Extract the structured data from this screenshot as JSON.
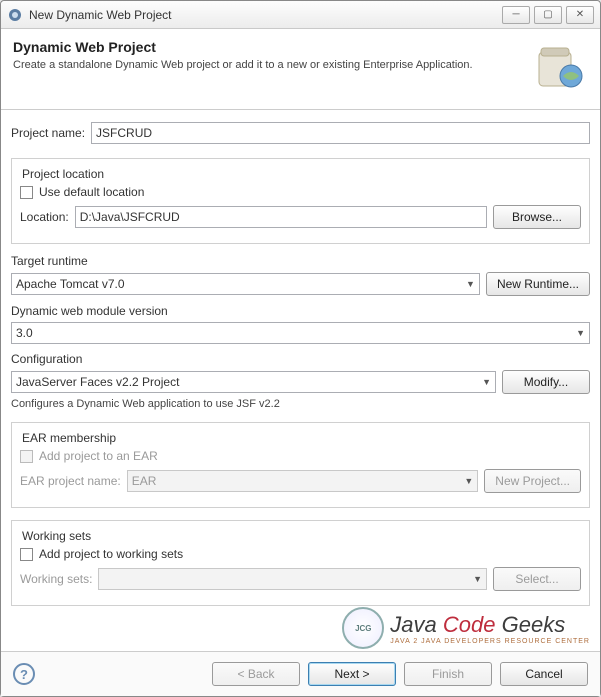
{
  "titlebar": {
    "title": "New Dynamic Web Project"
  },
  "banner": {
    "heading": "Dynamic Web Project",
    "desc": "Create a standalone Dynamic Web project or add it to a new or existing Enterprise Application."
  },
  "project_name": {
    "label": "Project name:",
    "value": "JSFCRUD"
  },
  "project_location": {
    "group": "Project location",
    "use_default_label": "Use default location",
    "use_default_checked": false,
    "location_label": "Location:",
    "location_value": "D:\\Java\\JSFCRUD",
    "browse": "Browse..."
  },
  "target_runtime": {
    "label": "Target runtime",
    "value": "Apache Tomcat v7.0",
    "new_runtime": "New Runtime..."
  },
  "module_version": {
    "label": "Dynamic web module version",
    "value": "3.0"
  },
  "configuration": {
    "label": "Configuration",
    "value": "JavaServer Faces v2.2 Project",
    "modify": "Modify...",
    "hint": "Configures a Dynamic Web application to use JSF v2.2"
  },
  "ear": {
    "group": "EAR membership",
    "add_label": "Add project to an EAR",
    "add_checked": false,
    "project_label": "EAR project name:",
    "project_value": "EAR",
    "new_project": "New Project..."
  },
  "working_sets": {
    "group": "Working sets",
    "add_label": "Add project to working sets",
    "add_checked": false,
    "label": "Working sets:",
    "value": "",
    "select": "Select..."
  },
  "footer": {
    "help": "?",
    "back": "< Back",
    "next": "Next >",
    "finish": "Finish",
    "cancel": "Cancel"
  },
  "watermark": {
    "logo": "JCG",
    "brand_java": "Java ",
    "brand_code": "Code ",
    "brand_geeks": "Geeks",
    "sub": "JAVA 2 JAVA DEVELOPERS RESOURCE CENTER"
  }
}
